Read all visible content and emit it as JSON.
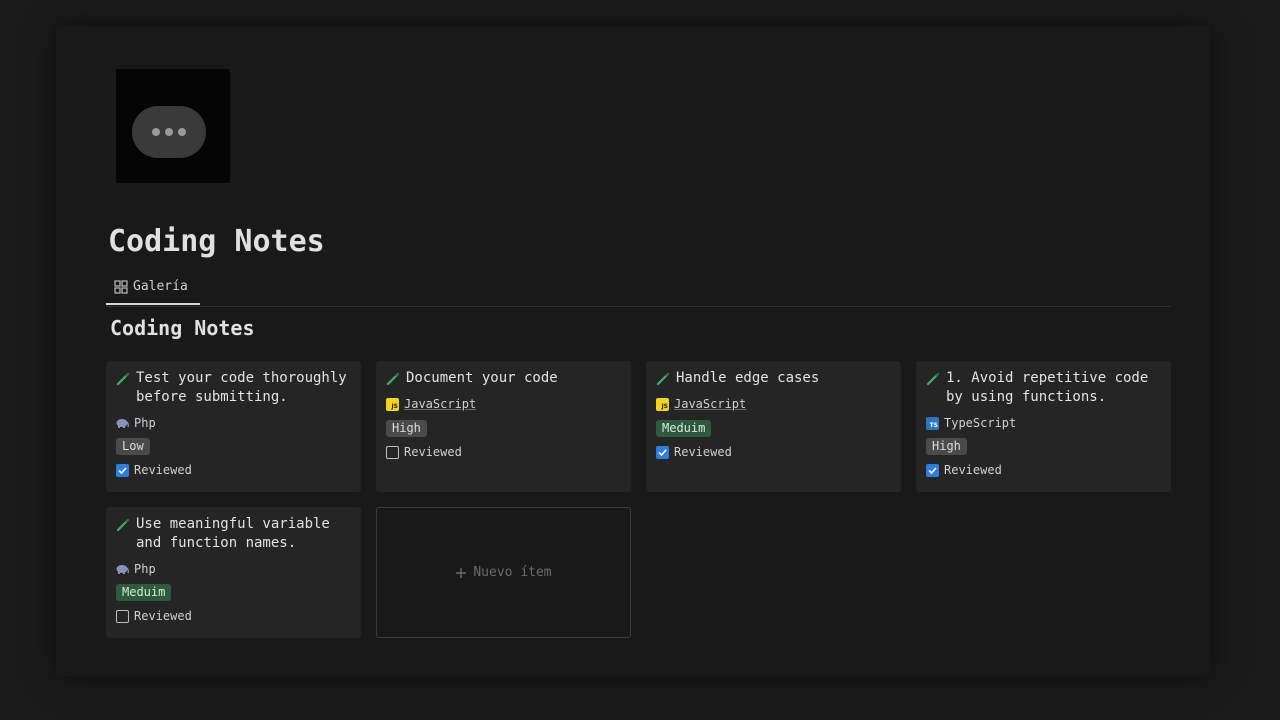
{
  "page": {
    "title": "Coding Notes",
    "cover_icon": "chat-bubble-ellipsis-icon"
  },
  "view_tab": {
    "label": "Galería",
    "icon": "gallery-grid-icon"
  },
  "section_title": "Coding Notes",
  "cards": [
    {
      "title": "Test your code thoroughly before submitting.",
      "language": "Php",
      "language_icon": "php-elephant-icon",
      "priority": "Low",
      "priority_color": "#4a4a4a",
      "reviewed_label": "Reviewed",
      "reviewed": true
    },
    {
      "title": "Document your code",
      "language": "JavaScript",
      "language_icon": "javascript-icon",
      "priority": "High",
      "priority_color": "#4a4a4a",
      "reviewed_label": "Reviewed",
      "reviewed": false
    },
    {
      "title": "Handle edge cases",
      "language": "JavaScript",
      "language_icon": "javascript-icon",
      "priority": "Meduim",
      "priority_color": "#2c5a3b",
      "reviewed_label": "Reviewed",
      "reviewed": true
    },
    {
      "title": "1. Avoid repetitive code by using functions.",
      "language": "TypeScript",
      "language_icon": "typescript-icon",
      "priority": "High",
      "priority_color": "#4a4a4a",
      "reviewed_label": "Reviewed",
      "reviewed": true
    },
    {
      "title": "Use meaningful variable and function names.",
      "language": "Php",
      "language_icon": "php-elephant-icon",
      "priority": "Meduim",
      "priority_color": "#2c5a3b",
      "reviewed_label": "Reviewed",
      "reviewed": false
    }
  ],
  "new_item": {
    "label": "Nuevo ítem",
    "icon": "plus-icon"
  },
  "js_badge_text": "JS",
  "ts_badge_text": "TS"
}
